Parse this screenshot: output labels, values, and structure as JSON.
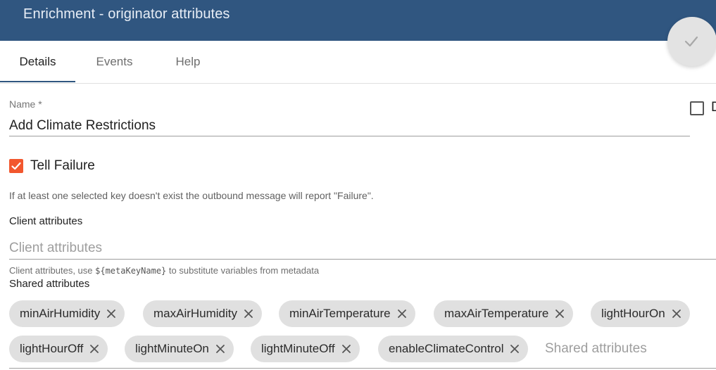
{
  "header": {
    "title": "Enrichment - originator attributes"
  },
  "tabs": [
    {
      "label": "Details",
      "active": true
    },
    {
      "label": "Events",
      "active": false
    },
    {
      "label": "Help",
      "active": false
    }
  ],
  "form": {
    "name_label": "Name *",
    "name_value": "Add Climate Restrictions",
    "debug_label": "D",
    "tell_failure": {
      "label": "Tell Failure",
      "checked": true
    },
    "tell_failure_hint": "If at least one selected key doesn't exist the outbound message will report \"Failure\".",
    "client_attributes": {
      "label": "Client attributes",
      "placeholder": "Client attributes",
      "value": "",
      "hint_prefix": "Client attributes, use ",
      "hint_code": "${metaKeyName}",
      "hint_suffix": " to substitute variables from metadata"
    },
    "shared_attributes": {
      "label": "Shared attributes",
      "placeholder": "Shared attributes",
      "chips": [
        "minAirHumidity",
        "maxAirHumidity",
        "minAirTemperature",
        "maxAirTemperature",
        "lightHourOn",
        "lightHourOff",
        "lightMinuteOn",
        "lightMinuteOff",
        "enableClimateControl"
      ]
    }
  },
  "colors": {
    "header_bg": "#305680",
    "accent_checkbox": "#f2572e",
    "chip_bg": "#e0e0e0"
  },
  "icons": {
    "save": "check-icon",
    "chip_remove": "close-icon",
    "checkbox_checked": "checkmark-icon"
  }
}
